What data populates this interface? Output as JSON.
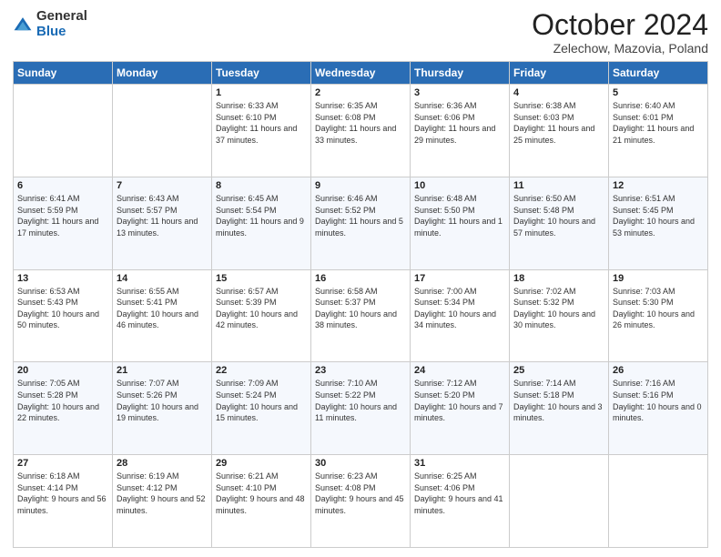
{
  "header": {
    "logo": {
      "general": "General",
      "blue": "Blue"
    },
    "title": "October 2024",
    "subtitle": "Zelechow, Mazovia, Poland"
  },
  "days_of_week": [
    "Sunday",
    "Monday",
    "Tuesday",
    "Wednesday",
    "Thursday",
    "Friday",
    "Saturday"
  ],
  "weeks": [
    [
      {
        "day": null
      },
      {
        "day": null
      },
      {
        "day": "1",
        "sunrise": "Sunrise: 6:33 AM",
        "sunset": "Sunset: 6:10 PM",
        "daylight": "Daylight: 11 hours and 37 minutes."
      },
      {
        "day": "2",
        "sunrise": "Sunrise: 6:35 AM",
        "sunset": "Sunset: 6:08 PM",
        "daylight": "Daylight: 11 hours and 33 minutes."
      },
      {
        "day": "3",
        "sunrise": "Sunrise: 6:36 AM",
        "sunset": "Sunset: 6:06 PM",
        "daylight": "Daylight: 11 hours and 29 minutes."
      },
      {
        "day": "4",
        "sunrise": "Sunrise: 6:38 AM",
        "sunset": "Sunset: 6:03 PM",
        "daylight": "Daylight: 11 hours and 25 minutes."
      },
      {
        "day": "5",
        "sunrise": "Sunrise: 6:40 AM",
        "sunset": "Sunset: 6:01 PM",
        "daylight": "Daylight: 11 hours and 21 minutes."
      }
    ],
    [
      {
        "day": "6",
        "sunrise": "Sunrise: 6:41 AM",
        "sunset": "Sunset: 5:59 PM",
        "daylight": "Daylight: 11 hours and 17 minutes."
      },
      {
        "day": "7",
        "sunrise": "Sunrise: 6:43 AM",
        "sunset": "Sunset: 5:57 PM",
        "daylight": "Daylight: 11 hours and 13 minutes."
      },
      {
        "day": "8",
        "sunrise": "Sunrise: 6:45 AM",
        "sunset": "Sunset: 5:54 PM",
        "daylight": "Daylight: 11 hours and 9 minutes."
      },
      {
        "day": "9",
        "sunrise": "Sunrise: 6:46 AM",
        "sunset": "Sunset: 5:52 PM",
        "daylight": "Daylight: 11 hours and 5 minutes."
      },
      {
        "day": "10",
        "sunrise": "Sunrise: 6:48 AM",
        "sunset": "Sunset: 5:50 PM",
        "daylight": "Daylight: 11 hours and 1 minute."
      },
      {
        "day": "11",
        "sunrise": "Sunrise: 6:50 AM",
        "sunset": "Sunset: 5:48 PM",
        "daylight": "Daylight: 10 hours and 57 minutes."
      },
      {
        "day": "12",
        "sunrise": "Sunrise: 6:51 AM",
        "sunset": "Sunset: 5:45 PM",
        "daylight": "Daylight: 10 hours and 53 minutes."
      }
    ],
    [
      {
        "day": "13",
        "sunrise": "Sunrise: 6:53 AM",
        "sunset": "Sunset: 5:43 PM",
        "daylight": "Daylight: 10 hours and 50 minutes."
      },
      {
        "day": "14",
        "sunrise": "Sunrise: 6:55 AM",
        "sunset": "Sunset: 5:41 PM",
        "daylight": "Daylight: 10 hours and 46 minutes."
      },
      {
        "day": "15",
        "sunrise": "Sunrise: 6:57 AM",
        "sunset": "Sunset: 5:39 PM",
        "daylight": "Daylight: 10 hours and 42 minutes."
      },
      {
        "day": "16",
        "sunrise": "Sunrise: 6:58 AM",
        "sunset": "Sunset: 5:37 PM",
        "daylight": "Daylight: 10 hours and 38 minutes."
      },
      {
        "day": "17",
        "sunrise": "Sunrise: 7:00 AM",
        "sunset": "Sunset: 5:34 PM",
        "daylight": "Daylight: 10 hours and 34 minutes."
      },
      {
        "day": "18",
        "sunrise": "Sunrise: 7:02 AM",
        "sunset": "Sunset: 5:32 PM",
        "daylight": "Daylight: 10 hours and 30 minutes."
      },
      {
        "day": "19",
        "sunrise": "Sunrise: 7:03 AM",
        "sunset": "Sunset: 5:30 PM",
        "daylight": "Daylight: 10 hours and 26 minutes."
      }
    ],
    [
      {
        "day": "20",
        "sunrise": "Sunrise: 7:05 AM",
        "sunset": "Sunset: 5:28 PM",
        "daylight": "Daylight: 10 hours and 22 minutes."
      },
      {
        "day": "21",
        "sunrise": "Sunrise: 7:07 AM",
        "sunset": "Sunset: 5:26 PM",
        "daylight": "Daylight: 10 hours and 19 minutes."
      },
      {
        "day": "22",
        "sunrise": "Sunrise: 7:09 AM",
        "sunset": "Sunset: 5:24 PM",
        "daylight": "Daylight: 10 hours and 15 minutes."
      },
      {
        "day": "23",
        "sunrise": "Sunrise: 7:10 AM",
        "sunset": "Sunset: 5:22 PM",
        "daylight": "Daylight: 10 hours and 11 minutes."
      },
      {
        "day": "24",
        "sunrise": "Sunrise: 7:12 AM",
        "sunset": "Sunset: 5:20 PM",
        "daylight": "Daylight: 10 hours and 7 minutes."
      },
      {
        "day": "25",
        "sunrise": "Sunrise: 7:14 AM",
        "sunset": "Sunset: 5:18 PM",
        "daylight": "Daylight: 10 hours and 3 minutes."
      },
      {
        "day": "26",
        "sunrise": "Sunrise: 7:16 AM",
        "sunset": "Sunset: 5:16 PM",
        "daylight": "Daylight: 10 hours and 0 minutes."
      }
    ],
    [
      {
        "day": "27",
        "sunrise": "Sunrise: 6:18 AM",
        "sunset": "Sunset: 4:14 PM",
        "daylight": "Daylight: 9 hours and 56 minutes."
      },
      {
        "day": "28",
        "sunrise": "Sunrise: 6:19 AM",
        "sunset": "Sunset: 4:12 PM",
        "daylight": "Daylight: 9 hours and 52 minutes."
      },
      {
        "day": "29",
        "sunrise": "Sunrise: 6:21 AM",
        "sunset": "Sunset: 4:10 PM",
        "daylight": "Daylight: 9 hours and 48 minutes."
      },
      {
        "day": "30",
        "sunrise": "Sunrise: 6:23 AM",
        "sunset": "Sunset: 4:08 PM",
        "daylight": "Daylight: 9 hours and 45 minutes."
      },
      {
        "day": "31",
        "sunrise": "Sunrise: 6:25 AM",
        "sunset": "Sunset: 4:06 PM",
        "daylight": "Daylight: 9 hours and 41 minutes."
      },
      {
        "day": null
      },
      {
        "day": null
      }
    ]
  ]
}
